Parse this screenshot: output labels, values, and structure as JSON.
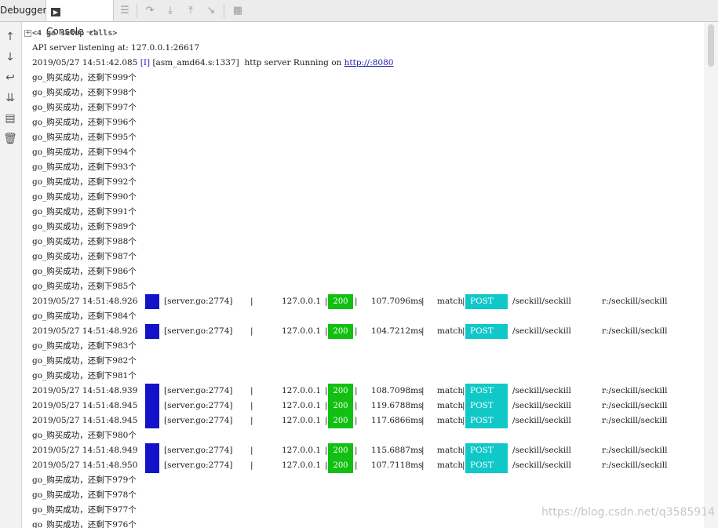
{
  "tabs": {
    "debugger": "Debugger",
    "console": "Console",
    "console_pin": "→*"
  },
  "toolbar": [
    "menu-icon",
    "step-over-icon",
    "step-into-icon",
    "step-out-icon",
    "run-to-cursor-icon",
    "evaluate-icon"
  ],
  "sidebar": [
    "up-arrow-icon",
    "down-arrow-icon",
    "soft-wrap-icon",
    "scroll-to-end-icon",
    "print-icon",
    "trash-icon"
  ],
  "console": {
    "setup_calls": "<4 go setup calls>",
    "api_line": "API server listening at: 127.0.0.1:26617",
    "server_line": {
      "ts": "2019/05/27 14:51:42.085",
      "level": "[I]",
      "src": "[asm_amd64.s:1337]",
      "msg": "http server Running on",
      "link": "http://:8080"
    },
    "lines": [
      {
        "type": "text",
        "text": "go_购买成功，还剩下999个"
      },
      {
        "type": "text",
        "text": "go_购买成功，还剩下998个"
      },
      {
        "type": "text",
        "text": "go_购买成功，还剩下997个"
      },
      {
        "type": "text",
        "text": "go_购买成功，还剩下996个"
      },
      {
        "type": "text",
        "text": "go_购买成功，还剩下995个"
      },
      {
        "type": "text",
        "text": "go_购买成功，还剩下994个"
      },
      {
        "type": "text",
        "text": "go_购买成功，还剩下993个"
      },
      {
        "type": "text",
        "text": "go_购买成功，还剩下992个"
      },
      {
        "type": "text",
        "text": "go_购买成功，还剩下990个"
      },
      {
        "type": "text",
        "text": "go_购买成功，还剩下991个"
      },
      {
        "type": "text",
        "text": "go_购买成功，还剩下989个"
      },
      {
        "type": "text",
        "text": "go_购买成功，还剩下988个"
      },
      {
        "type": "text",
        "text": "go_购买成功，还剩下987个"
      },
      {
        "type": "text",
        "text": "go_购买成功，还剩下986个"
      },
      {
        "type": "text",
        "text": "go_购买成功，还剩下985个"
      },
      {
        "type": "gin",
        "ts": "2019/05/27 14:51:48.926",
        "src": "[server.go:2774]",
        "ip": "127.0.0.1",
        "code": "200",
        "latency": "107.7096ms",
        "match": "match",
        "method": "POST",
        "path": "/seckill/seckill",
        "route": "r:/seckill/seckill"
      },
      {
        "type": "text",
        "text": "go_购买成功，还剩下984个"
      },
      {
        "type": "gin",
        "ts": "2019/05/27 14:51:48.926",
        "src": "[server.go:2774]",
        "ip": "127.0.0.1",
        "code": "200",
        "latency": "104.7212ms",
        "match": "match",
        "method": "POST",
        "path": "/seckill/seckill",
        "route": "r:/seckill/seckill"
      },
      {
        "type": "text",
        "text": "go_购买成功，还剩下983个"
      },
      {
        "type": "text",
        "text": "go_购买成功，还剩下982个"
      },
      {
        "type": "text",
        "text": "go_购买成功，还剩下981个"
      },
      {
        "type": "gin",
        "ts": "2019/05/27 14:51:48.939",
        "src": "[server.go:2774]",
        "ip": "127.0.0.1",
        "code": "200",
        "latency": "108.7098ms",
        "match": "match",
        "method": "POST",
        "path": "/seckill/seckill",
        "route": "r:/seckill/seckill"
      },
      {
        "type": "gin",
        "ts": "2019/05/27 14:51:48.945",
        "src": "[server.go:2774]",
        "ip": "127.0.0.1",
        "code": "200",
        "latency": "119.6788ms",
        "match": "match",
        "method": "POST",
        "path": "/seckill/seckill",
        "route": "r:/seckill/seckill"
      },
      {
        "type": "gin",
        "ts": "2019/05/27 14:51:48.945",
        "src": "[server.go:2774]",
        "ip": "127.0.0.1",
        "code": "200",
        "latency": "117.6866ms",
        "match": "match",
        "method": "POST",
        "path": "/seckill/seckill",
        "route": "r:/seckill/seckill"
      },
      {
        "type": "text",
        "text": "go_购买成功，还剩下980个"
      },
      {
        "type": "gin",
        "ts": "2019/05/27 14:51:48.949",
        "src": "[server.go:2774]",
        "ip": "127.0.0.1",
        "code": "200",
        "latency": "115.6887ms",
        "match": "match",
        "method": "POST",
        "path": "/seckill/seckill",
        "route": "r:/seckill/seckill"
      },
      {
        "type": "gin",
        "ts": "2019/05/27 14:51:48.950",
        "src": "[server.go:2774]",
        "ip": "127.0.0.1",
        "code": "200",
        "latency": "107.7118ms",
        "match": "match",
        "method": "POST",
        "path": "/seckill/seckill",
        "route": "r:/seckill/seckill"
      },
      {
        "type": "text",
        "text": "go_购买成功，还剩下979个"
      },
      {
        "type": "text",
        "text": "go_购买成功，还剩下978个"
      },
      {
        "type": "text",
        "text": "go_购买成功，还剩下977个"
      },
      {
        "type": "text",
        "text": "go_购买成功，还剩下976个"
      }
    ]
  },
  "watermark": "https://blog.csdn.net/q3585914"
}
